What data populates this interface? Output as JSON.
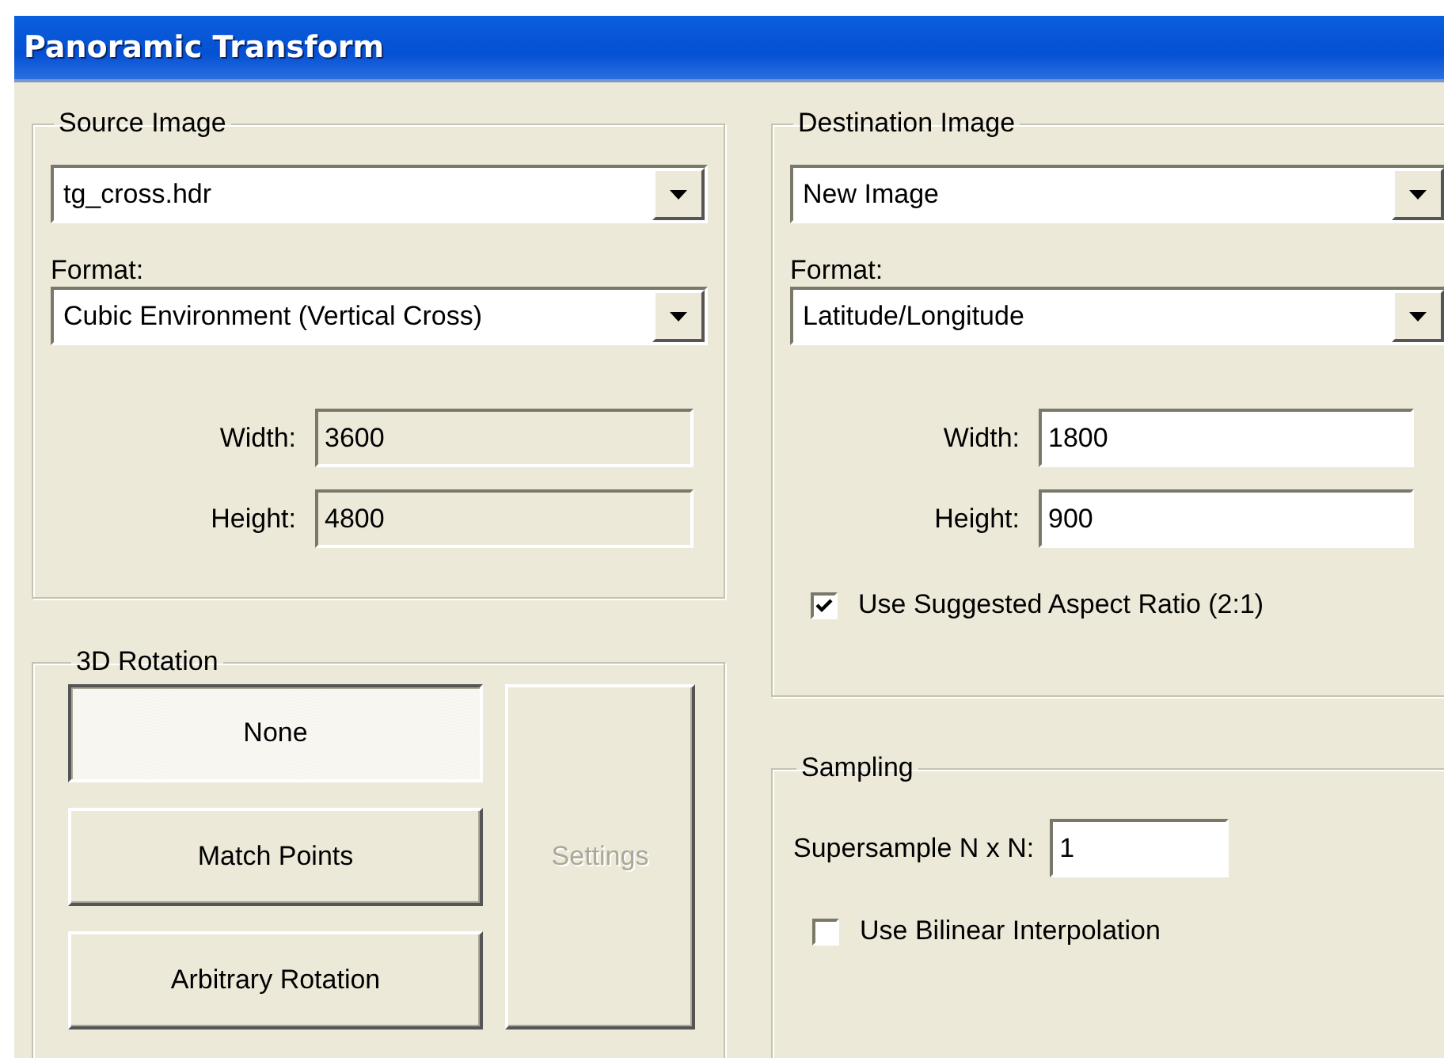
{
  "window": {
    "title": "Panoramic Transform"
  },
  "source_image": {
    "title": "Source Image",
    "file": {
      "value": "tg_cross.hdr"
    },
    "format_label": "Format:",
    "format": {
      "value": "Cubic Environment (Vertical Cross)"
    },
    "width": {
      "label": "Width:",
      "value": "3600",
      "disabled": true
    },
    "height": {
      "label": "Height:",
      "value": "4800",
      "disabled": true
    }
  },
  "rotation": {
    "title": "3D Rotation",
    "modes": [
      {
        "label": "None",
        "selected": true
      },
      {
        "label": "Match Points",
        "selected": false
      },
      {
        "label": "Arbitrary Rotation",
        "selected": false
      }
    ],
    "settings": {
      "label": "Settings",
      "disabled": true
    }
  },
  "destination_image": {
    "title": "Destination Image",
    "file": {
      "value": "New Image"
    },
    "format_label": "Format:",
    "format": {
      "value": "Latitude/Longitude"
    },
    "width": {
      "label": "Width:",
      "value": "1800",
      "disabled": false
    },
    "height": {
      "label": "Height:",
      "value": "900",
      "disabled": false
    },
    "aspect": {
      "label": "Use Suggested Aspect Ratio (2:1)",
      "checked": true
    }
  },
  "sampling": {
    "title": "Sampling",
    "supersample": {
      "label": "Supersample N x N:",
      "value": "1"
    },
    "bilinear": {
      "label": "Use Bilinear Interpolation",
      "checked": false
    }
  }
}
